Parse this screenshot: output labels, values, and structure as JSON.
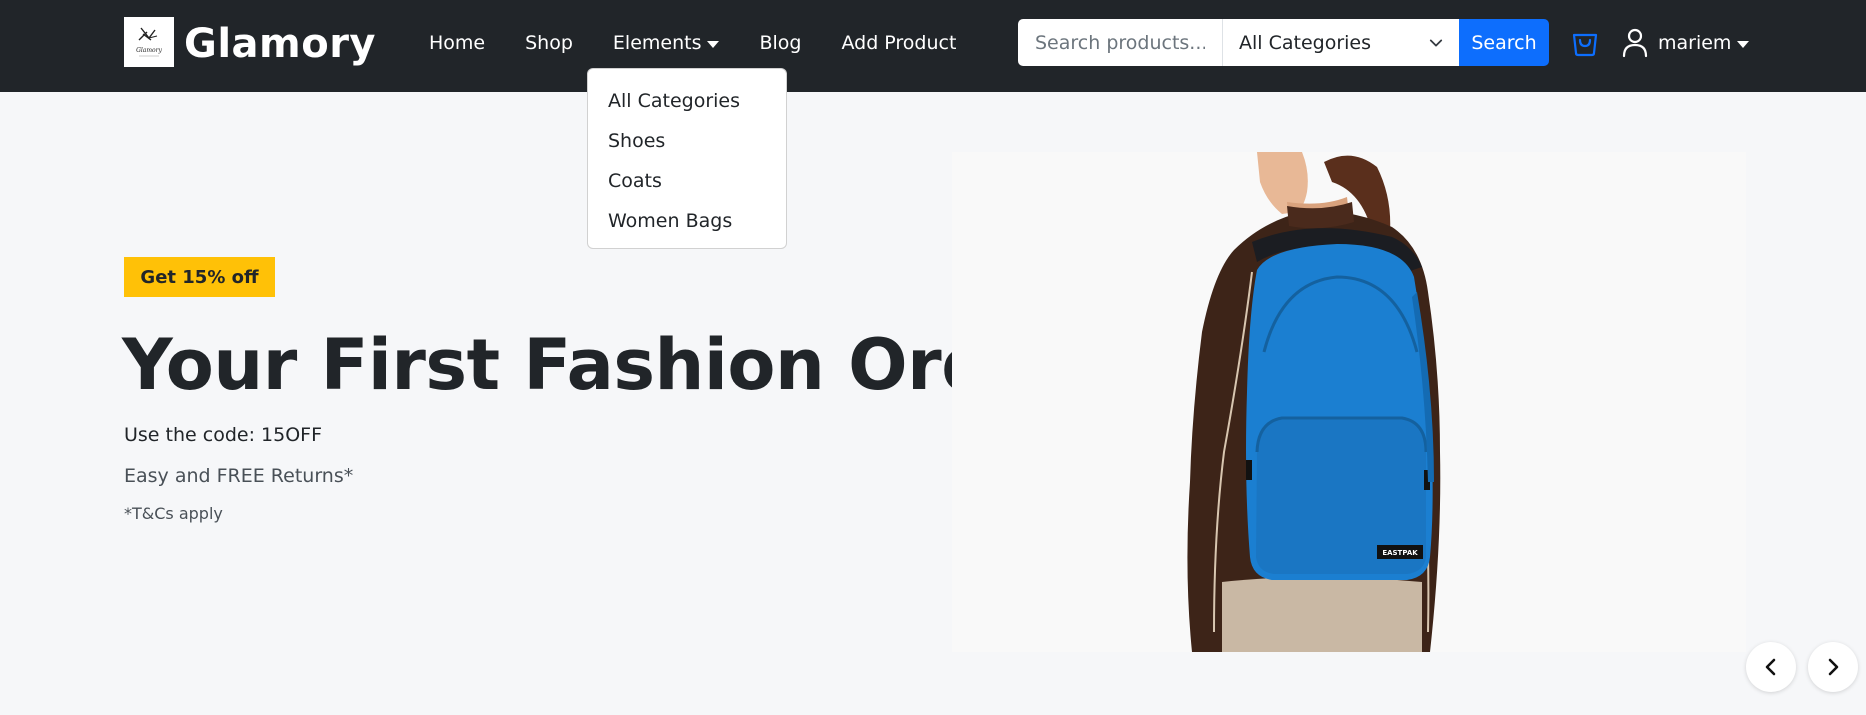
{
  "brand": {
    "name": "Glamory",
    "logo_text": "Glamory"
  },
  "nav": {
    "home": "Home",
    "shop": "Shop",
    "elements": "Elements",
    "blog": "Blog",
    "add_product": "Add Product"
  },
  "search": {
    "placeholder": "Search products...",
    "category_selected": "All Categories",
    "button": "Search"
  },
  "user": {
    "name": "mariem"
  },
  "dropdown": {
    "items": [
      "All Categories",
      "Shoes",
      "Coats",
      "Women Bags"
    ]
  },
  "hero": {
    "badge": "Get 15% off",
    "title": "Your First Fashion Order",
    "code_line": "Use the code: 15OFF",
    "returns": "Easy and FREE Returns*",
    "terms": "*T&Cs apply",
    "bag_label": "EASTPAK"
  },
  "colors": {
    "navbar": "#212529",
    "accent": "#0d6efd",
    "badge": "#ffc107",
    "backpack": "#1b7fd1"
  },
  "icons": [
    "logo-icon",
    "chevron-down-icon",
    "cart-icon",
    "user-icon",
    "chevron-left-icon",
    "chevron-right-icon"
  ]
}
